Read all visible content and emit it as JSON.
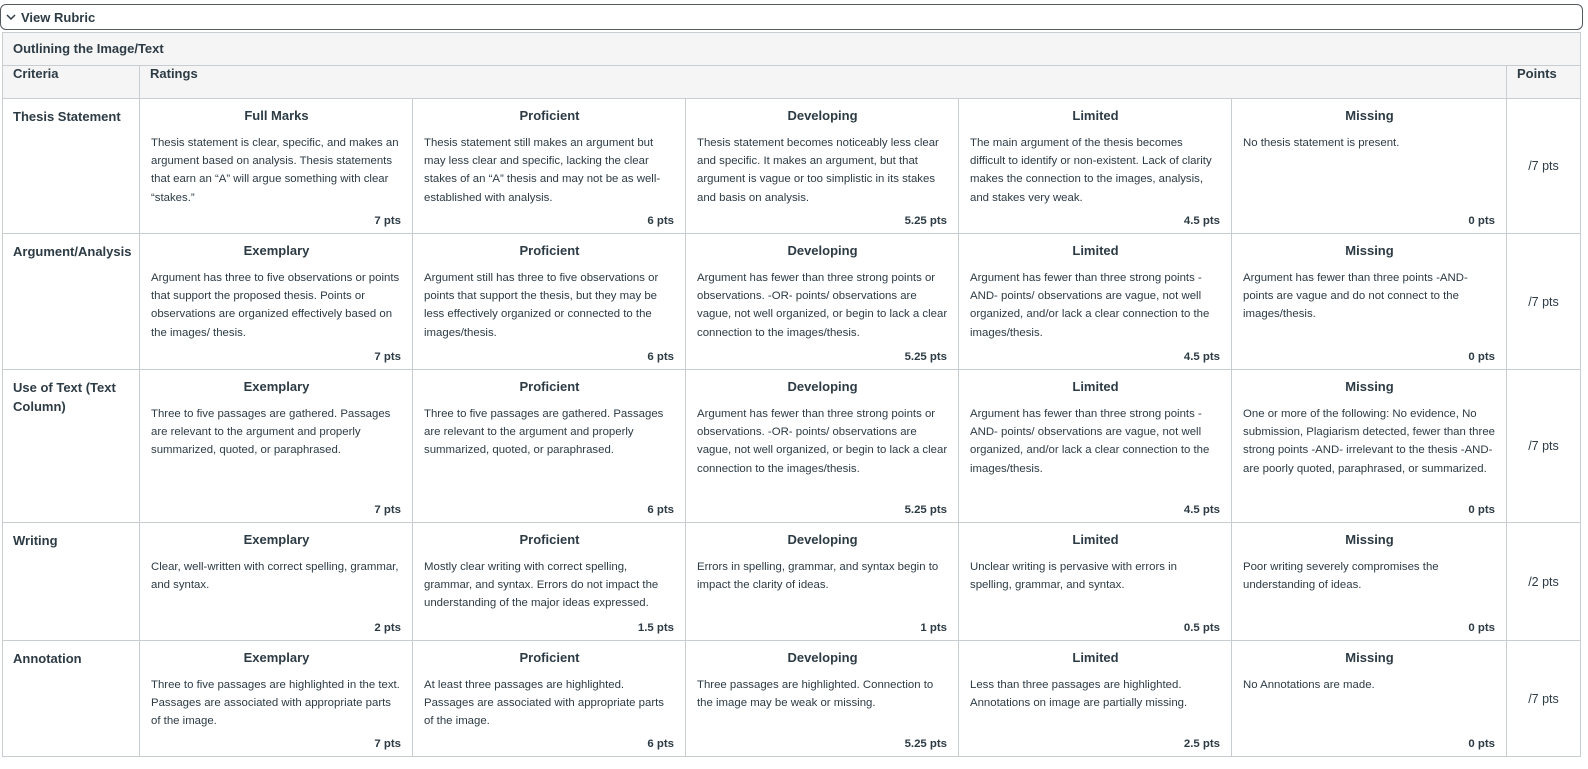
{
  "toggle": {
    "label": "View Rubric",
    "icon": "chevron-down-icon"
  },
  "rubric": {
    "title": "Outlining the Image/Text",
    "headers": {
      "criteria": "Criteria",
      "ratings": "Ratings",
      "points": "Points"
    },
    "rows": [
      {
        "criterion": "Thesis Statement",
        "points": "/7 pts",
        "ratings": [
          {
            "title": "Full Marks",
            "desc": "Thesis statement is clear, specific, and makes an argument based on analysis. Thesis statements that earn an “A” will argue something with clear “stakes.”",
            "pts": "7 pts"
          },
          {
            "title": "Proficient",
            "desc": "Thesis statement still makes an argument but may less clear and specific, lacking the clear stakes of an “A” thesis and may not be as well-established with analysis.",
            "pts": "6 pts"
          },
          {
            "title": "Developing",
            "desc": "Thesis statement becomes noticeably less clear and specific. It makes an argument, but that argument is vague or too simplistic in its stakes and basis on analysis.",
            "pts": "5.25 pts"
          },
          {
            "title": "Limited",
            "desc": "The main argument of the thesis becomes difficult to identify or non-existent. Lack of clarity makes the connection to the images, analysis, and stakes very weak.",
            "pts": "4.5 pts"
          },
          {
            "title": "Missing",
            "desc": "No thesis statement is present.",
            "pts": "0 pts"
          }
        ]
      },
      {
        "criterion": "Argument/Analysis",
        "points": "/7 pts",
        "ratings": [
          {
            "title": "Exemplary",
            "desc": "Argument has three to five observations or points that support the proposed thesis. Points or observations are organized effectively based on the images/ thesis.",
            "pts": "7 pts"
          },
          {
            "title": "Proficient",
            "desc": "Argument still has three to five observations or points that support the thesis, but they may be less effectively organized or connected to the images/thesis.",
            "pts": "6 pts"
          },
          {
            "title": "Developing",
            "desc": "Argument has fewer than three strong points or observations. -OR- points/ observations are vague, not well organized, or begin to lack a clear connection to the images/thesis.",
            "pts": "5.25 pts"
          },
          {
            "title": "Limited",
            "desc": "Argument has fewer than three strong points -AND- points/ observations are vague, not well organized, and/or lack a clear connection to the images/thesis.",
            "pts": "4.5 pts"
          },
          {
            "title": "Missing",
            "desc": "Argument has fewer than three points -AND- points are vague and do not connect to the images/thesis.",
            "pts": "0 pts"
          }
        ]
      },
      {
        "criterion": "Use of Text (Text Column)",
        "points": "/7 pts",
        "ratings": [
          {
            "title": "Exemplary",
            "desc": "Three to five passages are gathered. Passages are relevant to the argument and properly summarized, quoted, or paraphrased.",
            "pts": "7 pts"
          },
          {
            "title": "Proficient",
            "desc": "Three to five passages are gathered. Passages are relevant to the argument and properly summarized, quoted, or paraphrased.",
            "pts": "6 pts"
          },
          {
            "title": "Developing",
            "desc": "Argument has fewer than three strong points or observations. -OR- points/ observations are vague, not well organized, or begin to lack a clear connection to the images/thesis.",
            "pts": "5.25 pts"
          },
          {
            "title": "Limited",
            "desc": "Argument has fewer than three strong points -AND- points/ observations are vague, not well organized, and/or lack a clear connection to the images/thesis.",
            "pts": "4.5 pts"
          },
          {
            "title": "Missing",
            "desc": "One or more of the following: No evidence, No submission, Plagiarism detected, fewer than three strong points -AND- irrelevant to the thesis -AND- are poorly quoted, paraphrased, or summarized.",
            "pts": "0 pts"
          }
        ]
      },
      {
        "criterion": "Writing",
        "points": "/2 pts",
        "ratings": [
          {
            "title": "Exemplary",
            "desc": "Clear, well-written with correct spelling, grammar, and syntax.",
            "pts": "2 pts"
          },
          {
            "title": "Proficient",
            "desc": "Mostly clear writing with correct spelling, grammar, and syntax. Errors do not impact the understanding of the major ideas expressed.",
            "pts": "1.5 pts"
          },
          {
            "title": "Developing",
            "desc": "Errors in spelling, grammar, and syntax begin to impact the clarity of ideas.",
            "pts": "1 pts"
          },
          {
            "title": "Limited",
            "desc": "Unclear writing is pervasive with errors in spelling, grammar, and syntax.",
            "pts": "0.5 pts"
          },
          {
            "title": "Missing",
            "desc": "Poor writing severely compromises the understanding of ideas.",
            "pts": "0 pts"
          }
        ]
      },
      {
        "criterion": "Annotation",
        "points": "/7 pts",
        "ratings": [
          {
            "title": "Exemplary",
            "desc": "Three to five passages are highlighted in the text. Passages are associated with appropriate parts of the image.",
            "pts": "7 pts"
          },
          {
            "title": "Proficient",
            "desc": "At least three passages are highlighted. Passages are associated with appropriate parts of the image.",
            "pts": "6 pts"
          },
          {
            "title": "Developing",
            "desc": "Three passages are highlighted. Connection to the image may be weak or missing.",
            "pts": "5.25 pts"
          },
          {
            "title": "Limited",
            "desc": "Less than three passages are highlighted. Annotations on image are partially missing.",
            "pts": "2.5 pts"
          },
          {
            "title": "Missing",
            "desc": "No Annotations are made.",
            "pts": "0 pts"
          }
        ]
      }
    ]
  }
}
